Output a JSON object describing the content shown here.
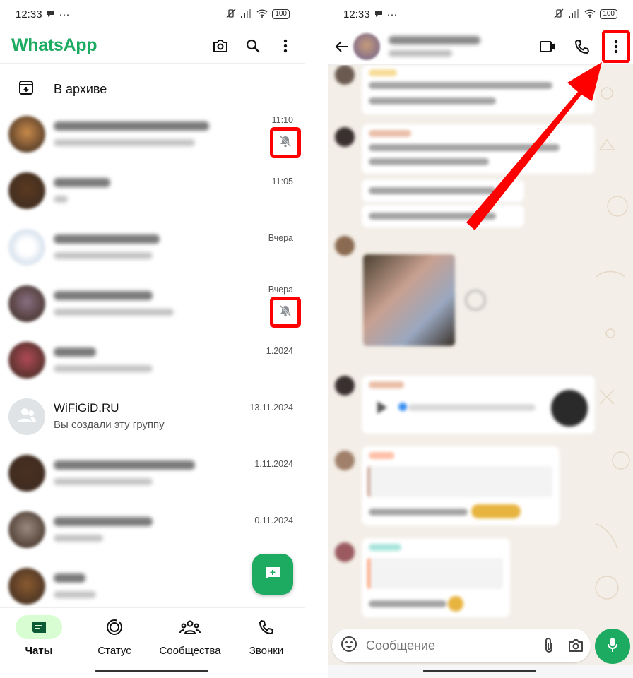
{
  "status_bar": {
    "time": "12:33",
    "battery": "100",
    "icons": [
      "chat-notification-icon",
      "more-dots-icon",
      "mute-vibrate-icon",
      "signal-icon",
      "wifi-icon",
      "battery-icon"
    ]
  },
  "chats_screen": {
    "app_title": "WhatsApp",
    "header_icons": [
      "camera-icon",
      "search-icon",
      "overflow-menu-icon"
    ],
    "archive_label": "В архиве",
    "chats": [
      {
        "name": "",
        "preview": "",
        "time": "11:10",
        "muted": true,
        "blurred": true,
        "avatar_color": "#c98a4a"
      },
      {
        "name": "",
        "preview": "",
        "time": "11:05",
        "muted": false,
        "blurred": true,
        "avatar_color": "#5a3a20"
      },
      {
        "name": "",
        "preview": "",
        "time": "Вчера",
        "muted": false,
        "blurred": true,
        "avatar_color": "#dde6f0"
      },
      {
        "name": "",
        "preview": "",
        "time": "Вчера",
        "muted": true,
        "blurred": true,
        "avatar_color": "#8a6f80"
      },
      {
        "name": "",
        "preview": "",
        "time": "1.2024",
        "muted": false,
        "blurred": true,
        "avatar_color": "#b04a55"
      },
      {
        "name": "WiFiGiD.RU",
        "preview": "Вы создали эту группу",
        "time": "13.11.2024",
        "muted": false,
        "blurred": false,
        "avatar_color": "#dfe3e6"
      },
      {
        "name": "",
        "preview": "",
        "time": "1.11.2024",
        "muted": false,
        "blurred": true,
        "avatar_color": "#4a3020"
      },
      {
        "name": "",
        "preview": "",
        "time": "0.11.2024",
        "muted": false,
        "blurred": true,
        "avatar_color": "#9a8a80"
      },
      {
        "name": "",
        "preview": "",
        "time": "",
        "muted": false,
        "blurred": true,
        "avatar_color": "#8a5a30"
      }
    ],
    "fab_icon": "new-chat-icon",
    "bottom_nav": [
      {
        "label": "Чаты",
        "icon": "chats-icon",
        "active": true
      },
      {
        "label": "Статус",
        "icon": "status-icon",
        "active": false
      },
      {
        "label": "Сообщества",
        "icon": "communities-icon",
        "active": false
      },
      {
        "label": "Звонки",
        "icon": "calls-icon",
        "active": false
      }
    ]
  },
  "conversation_screen": {
    "header_icons": [
      "back-arrow-icon",
      "video-call-icon",
      "voice-call-icon",
      "overflow-menu-icon"
    ],
    "composer_placeholder": "Сообщение",
    "composer_icons": [
      "emoji-icon",
      "attach-icon",
      "camera-icon"
    ],
    "mic_icon": "mic-icon"
  },
  "annotations": {
    "highlight_color": "#ff0000",
    "highlighted": [
      "mute-icon-chat-1",
      "mute-icon-chat-4",
      "conversation-overflow-menu"
    ]
  }
}
